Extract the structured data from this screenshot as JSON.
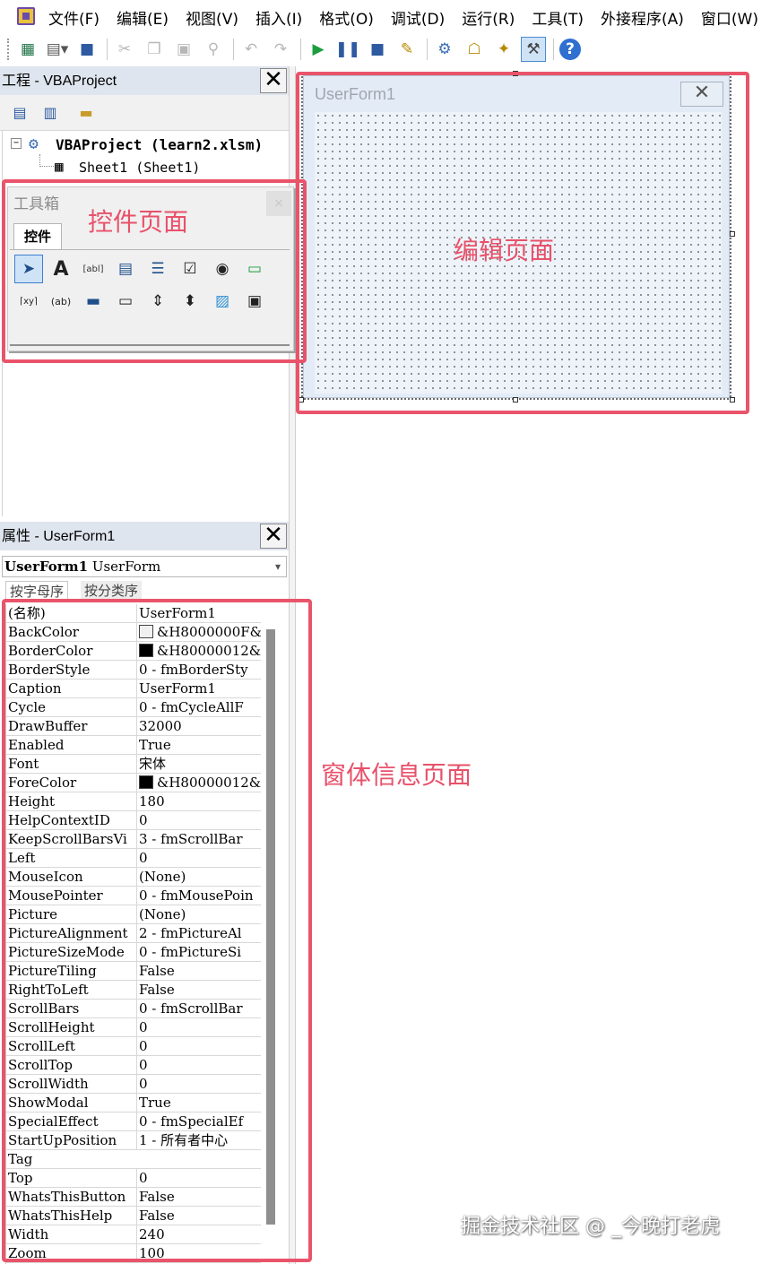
{
  "menubar": {
    "items": [
      "文件(F)",
      "编辑(E)",
      "视图(V)",
      "插入(I)",
      "格式(O)",
      "调试(D)",
      "运行(R)",
      "工具(T)",
      "外接程序(A)",
      "窗口(W)"
    ]
  },
  "toolbar": {
    "icons": [
      "excel-view-icon",
      "insert-userform-icon",
      "save-icon",
      "cut-icon",
      "copy-icon",
      "paste-icon",
      "find-icon",
      "undo-icon",
      "redo-icon",
      "run-icon",
      "break-icon",
      "reset-icon",
      "design-mode-icon",
      "project-explorer-icon",
      "properties-icon",
      "object-browser-icon",
      "toolbox-icon",
      "help-icon"
    ]
  },
  "project": {
    "title": "工程 - VBAProject",
    "close": "✕",
    "tree": {
      "root": "VBAProject  (learn2.xlsm)",
      "child": "Sheet1  (Sheet1)"
    }
  },
  "toolbox": {
    "title": "工具箱",
    "close": "×",
    "tab": "控件",
    "tools_row1": [
      "pointer-tool",
      "label-tool",
      "textbox-tool",
      "combobox-tool",
      "listbox-tool",
      "checkbox-tool",
      "optionbutton-tool",
      "togglebutton-tool"
    ],
    "tools_row2": [
      "frame-tool",
      "commandbutton-tool",
      "tabstrip-tool",
      "multipage-tool",
      "scrollbar-tool",
      "spinbutton-tool",
      "image-tool",
      "refedit-tool"
    ]
  },
  "designer": {
    "form_title": "UserForm1",
    "close": "✕"
  },
  "properties": {
    "title": "属性 - UserForm1",
    "close": "✕",
    "object_name": "UserForm1",
    "object_type": "UserForm",
    "tab_alpha": "按字母序",
    "tab_category": "按分类序",
    "rows": [
      {
        "name": "(名称)",
        "value": "UserForm1"
      },
      {
        "name": "BackColor",
        "value": "&H8000000F&",
        "swatch": "#f0f0f0"
      },
      {
        "name": "BorderColor",
        "value": "&H80000012&",
        "swatch": "#000000"
      },
      {
        "name": "BorderStyle",
        "value": "0 - fmBorderSty"
      },
      {
        "name": "Caption",
        "value": "UserForm1"
      },
      {
        "name": "Cycle",
        "value": "0 - fmCycleAllF"
      },
      {
        "name": "DrawBuffer",
        "value": "32000"
      },
      {
        "name": "Enabled",
        "value": "True"
      },
      {
        "name": "Font",
        "value": "宋体"
      },
      {
        "name": "ForeColor",
        "value": "&H80000012&",
        "swatch": "#000000"
      },
      {
        "name": "Height",
        "value": "180"
      },
      {
        "name": "HelpContextID",
        "value": "0"
      },
      {
        "name": "KeepScrollBarsVi",
        "value": "3 - fmScrollBar"
      },
      {
        "name": "Left",
        "value": "0"
      },
      {
        "name": "MouseIcon",
        "value": "(None)"
      },
      {
        "name": "MousePointer",
        "value": "0 - fmMousePoin"
      },
      {
        "name": "Picture",
        "value": "(None)"
      },
      {
        "name": "PictureAlignment",
        "value": "2 - fmPictureAl"
      },
      {
        "name": "PictureSizeMode",
        "value": "0 - fmPictureSi"
      },
      {
        "name": "PictureTiling",
        "value": "False"
      },
      {
        "name": "RightToLeft",
        "value": "False"
      },
      {
        "name": "ScrollBars",
        "value": "0 - fmScrollBar"
      },
      {
        "name": "ScrollHeight",
        "value": "0"
      },
      {
        "name": "ScrollLeft",
        "value": "0"
      },
      {
        "name": "ScrollTop",
        "value": "0"
      },
      {
        "name": "ScrollWidth",
        "value": "0"
      },
      {
        "name": "ShowModal",
        "value": "True"
      },
      {
        "name": "SpecialEffect",
        "value": "0 - fmSpecialEf"
      },
      {
        "name": "StartUpPosition",
        "value": "1 - 所有者中心"
      },
      {
        "name": "Tag",
        "value": ""
      },
      {
        "name": "Top",
        "value": "0"
      },
      {
        "name": "WhatsThisButton",
        "value": "False"
      },
      {
        "name": "WhatsThisHelp",
        "value": "False"
      },
      {
        "name": "Width",
        "value": "240"
      },
      {
        "name": "Zoom",
        "value": "100"
      }
    ]
  },
  "annotations": {
    "toolbox_label": "控件页面",
    "designer_label": "编辑页面",
    "properties_label": "窗体信息页面",
    "color": "#e9546a"
  },
  "watermark": "掘金技术社区 @ _今晚打老虎"
}
